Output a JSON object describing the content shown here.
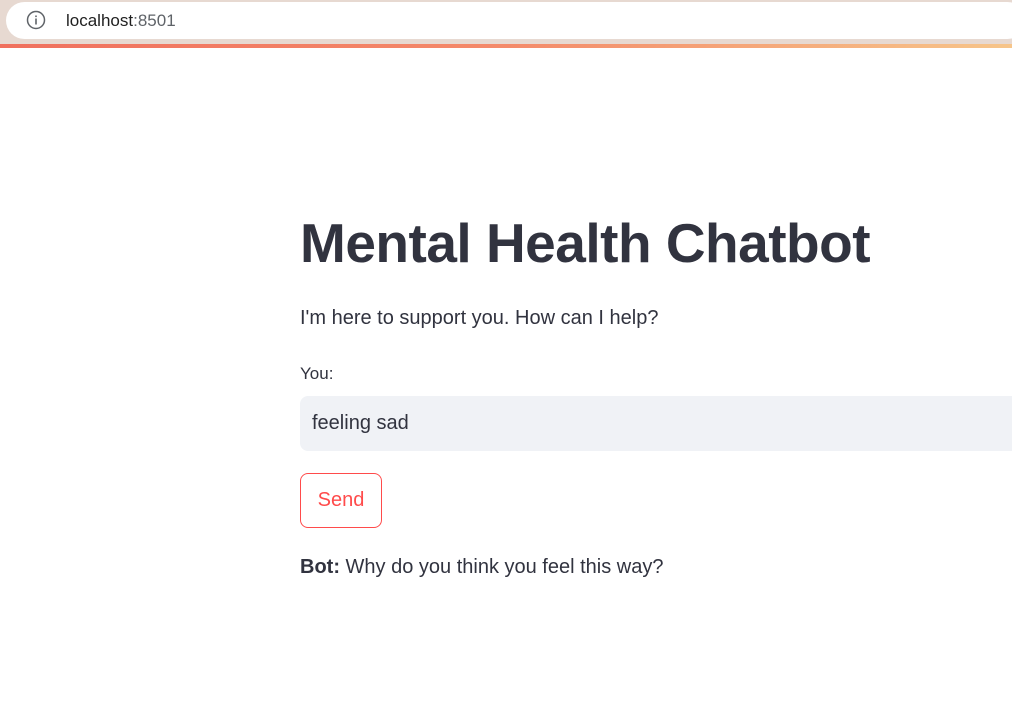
{
  "browser": {
    "url_host": "localhost",
    "url_port": ":8501",
    "info_icon": "info-icon"
  },
  "app": {
    "title": "Mental Health Chatbot",
    "subtitle": "I'm here to support you. How can I help?",
    "input": {
      "label": "You:",
      "value": "feeling sad",
      "placeholder": ""
    },
    "send_label": "Send",
    "response": {
      "prefix": "Bot:",
      "text": " Why do you think you feel this way?"
    }
  },
  "colors": {
    "text": "#31333f",
    "accent": "#ff4b4b",
    "input_bg": "#f0f2f6"
  }
}
